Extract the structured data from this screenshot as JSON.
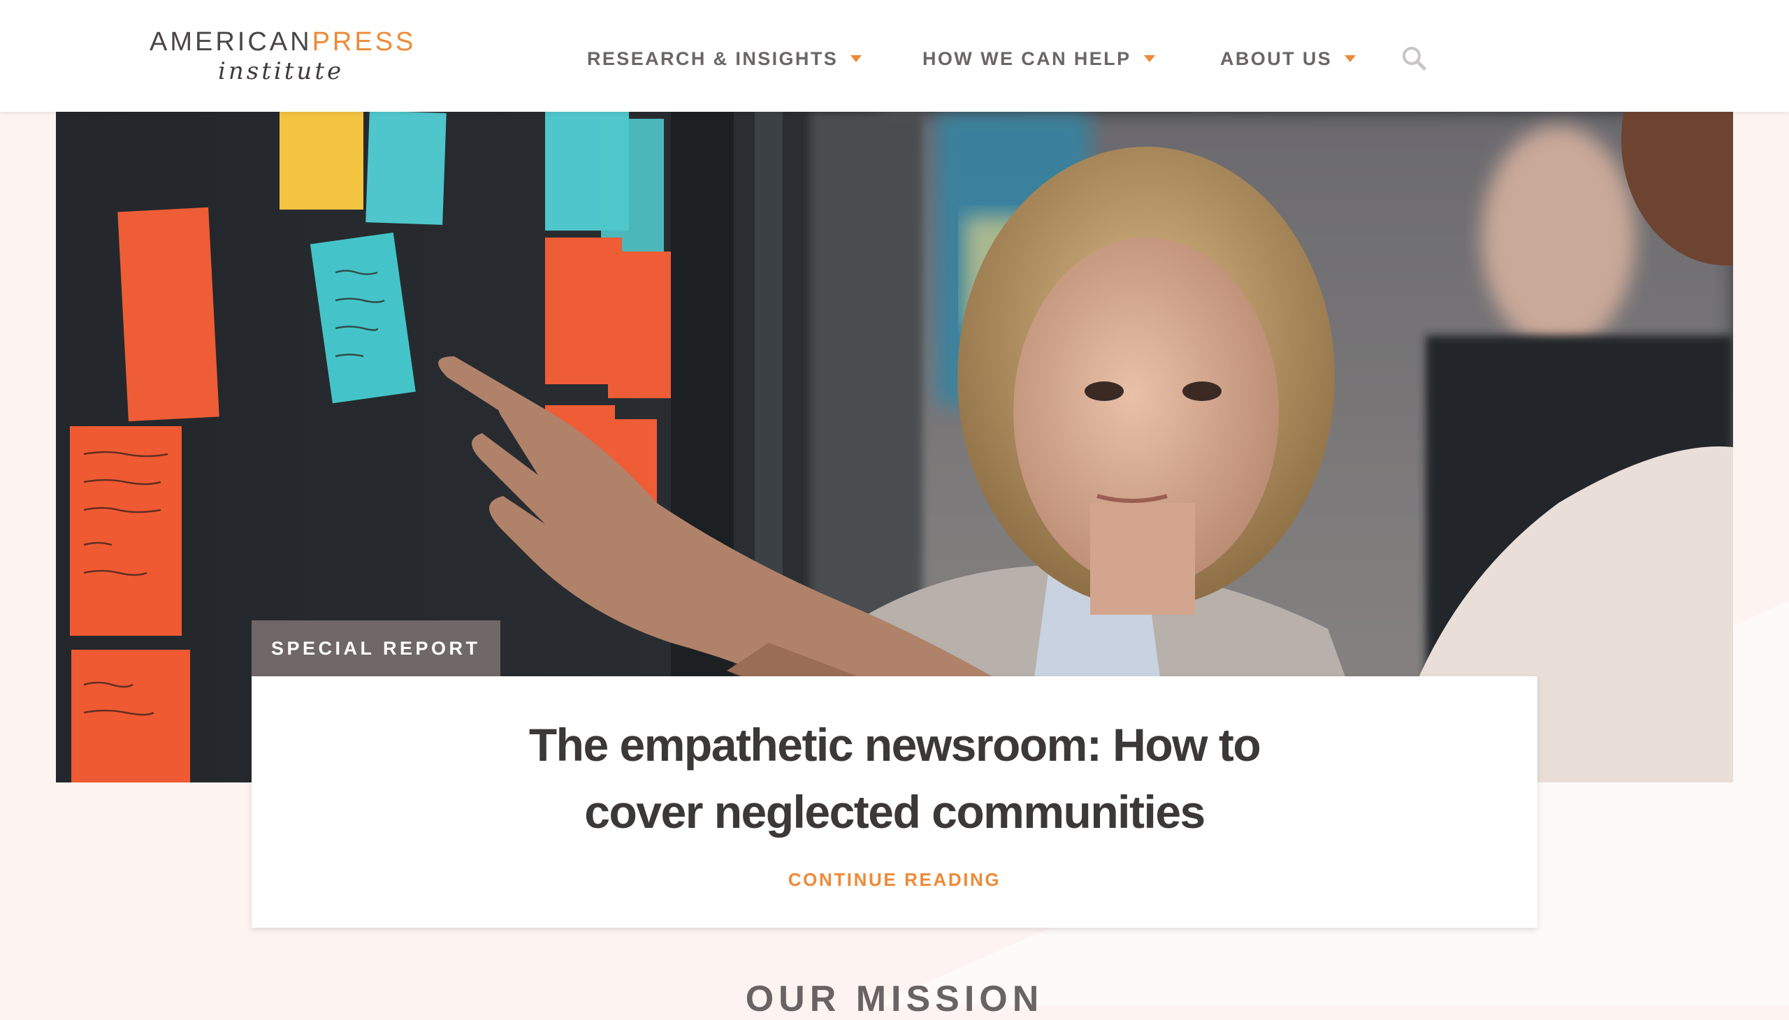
{
  "brand": {
    "logo_top_a": "AMERICAN",
    "logo_top_b": "PRESS",
    "logo_bottom": "institute",
    "accent_color": "#ee8a37",
    "text_color": "#4a4546"
  },
  "nav": {
    "items": [
      {
        "label": "RESEARCH & INSIGHTS",
        "icon": "caret-down-icon"
      },
      {
        "label": "HOW WE CAN HELP",
        "icon": "caret-down-icon"
      },
      {
        "label": "ABOUT US",
        "icon": "caret-down-icon"
      }
    ],
    "search_icon": "search-icon"
  },
  "hero": {
    "image_subject": "photo of colleagues arranging sticky notes on a dark wall",
    "tag": "SPECIAL REPORT",
    "title": "The empathetic newsroom: How to cover neglected communities",
    "cta": "CONTINUE READING",
    "tag_color": "#6f6768"
  },
  "mission": {
    "heading": "OUR MISSION"
  }
}
